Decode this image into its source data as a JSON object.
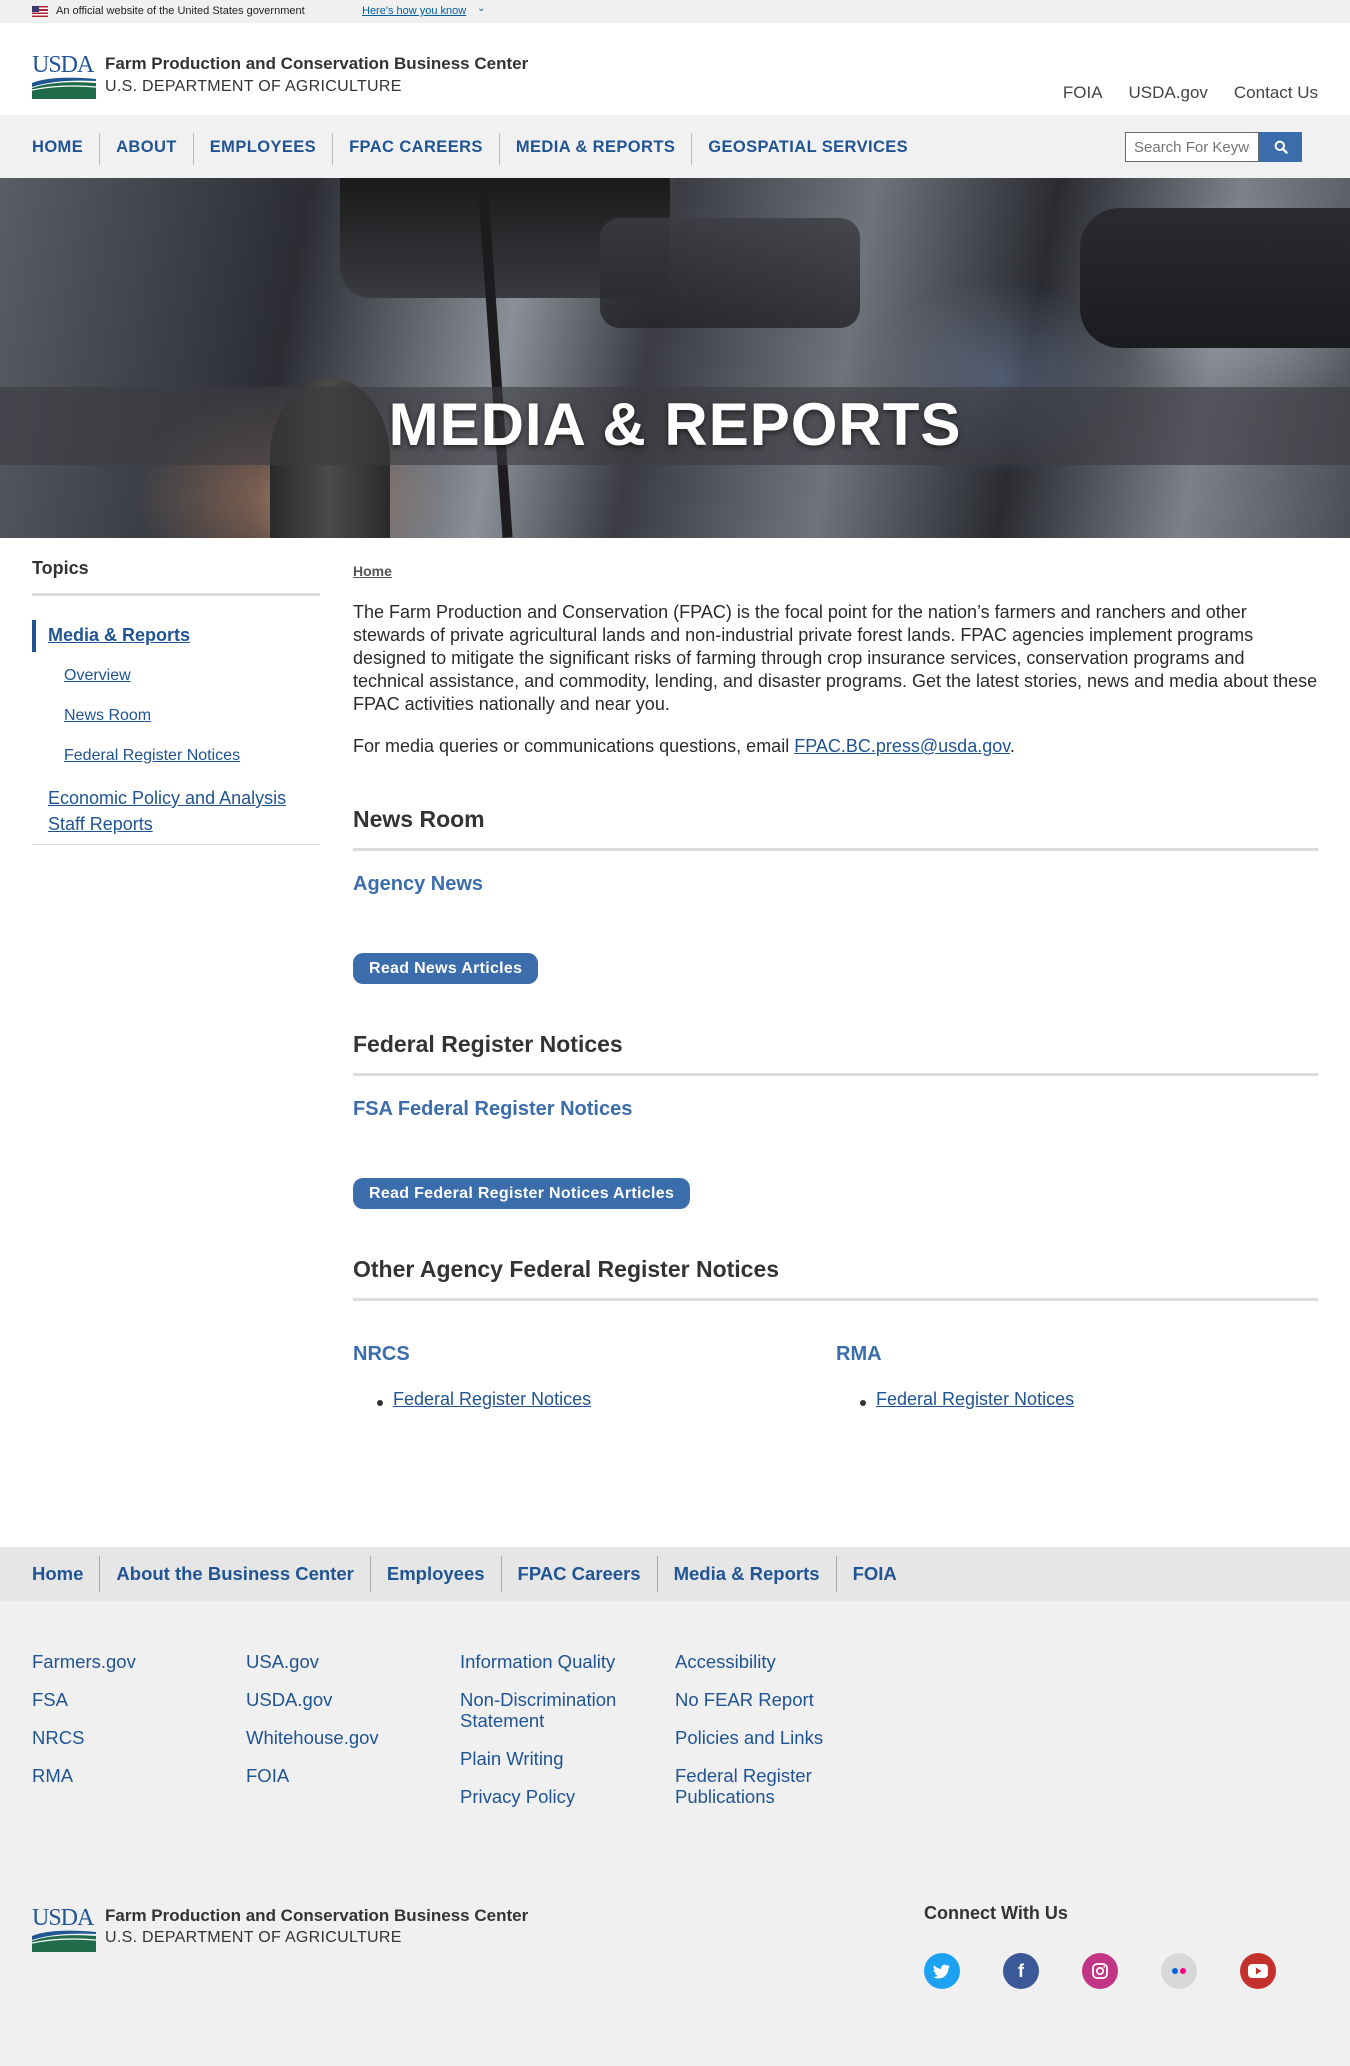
{
  "banner": {
    "official": "An official website of the United States government",
    "how_you_know": "Here's how you know"
  },
  "header": {
    "logo_text": "USDA",
    "title": "Farm Production and Conservation Business Center",
    "subtitle": "U.S. DEPARTMENT OF AGRICULTURE",
    "utility_links": [
      "FOIA",
      "USDA.gov",
      "Contact Us"
    ]
  },
  "nav": {
    "items": [
      "HOME",
      "ABOUT",
      "EMPLOYEES",
      "FPAC CAREERS",
      "MEDIA & REPORTS",
      "GEOSPATIAL SERVICES"
    ],
    "search_placeholder": "Search For Keywords"
  },
  "hero": {
    "title": "MEDIA & REPORTS"
  },
  "sidebar": {
    "heading": "Topics",
    "active": "Media & Reports",
    "sub_items": [
      "Overview",
      "News Room",
      "Federal Register Notices"
    ],
    "other": "Economic Policy and Analysis Staff Reports"
  },
  "content": {
    "breadcrumb": "Home",
    "intro": "The Farm Production and Conservation (FPAC) is the focal point for the nation’s farmers and ranchers and other stewards of private agricultural lands and non-industrial private forest lands. FPAC agencies implement programs designed to mitigate the significant risks of farming through crop insurance services, conservation programs and technical assistance, and commodity, lending, and disaster programs. Get the latest stories, news and media about these FPAC activities nationally and near you.",
    "contact_prefix": "For media queries or communications questions, email ",
    "contact_email": "FPAC.BC.press@usda.gov",
    "contact_suffix": ".",
    "news_room": {
      "title": "News Room",
      "subtitle": "Agency News",
      "button": "Read News Articles"
    },
    "frn": {
      "title": "Federal Register Notices",
      "subtitle": "FSA Federal Register Notices",
      "button": "Read Federal Register Notices Articles"
    },
    "other": {
      "title": "Other Agency Federal Register Notices",
      "agencies": [
        {
          "name": "NRCS",
          "link": "Federal Register Notices"
        },
        {
          "name": "RMA",
          "link": "Federal Register Notices"
        }
      ]
    }
  },
  "footer_nav": [
    "Home",
    "About the Business Center",
    "Employees",
    "FPAC Careers",
    "Media & Reports",
    "FOIA"
  ],
  "footer": {
    "col1": [
      "Farmers.gov",
      "FSA",
      "NRCS",
      "RMA"
    ],
    "col2": [
      "USA.gov",
      "USDA.gov",
      "Whitehouse.gov",
      "FOIA"
    ],
    "col3": [
      "Information Quality",
      "Non-Discrimination Statement",
      "Plain Writing",
      "Privacy Policy"
    ],
    "col4": [
      "Accessibility",
      "No FEAR Report",
      "Policies and Links",
      "Federal Register Publications"
    ],
    "connect": "Connect With Us",
    "social": [
      {
        "icon": "twitter-icon",
        "color": "#1da1f2"
      },
      {
        "icon": "facebook-icon",
        "color": "#3b5998"
      },
      {
        "icon": "instagram-icon",
        "color": "#c13584"
      },
      {
        "icon": "flickr-icon",
        "color": "#d8d8d8"
      },
      {
        "icon": "youtube-icon",
        "color": "#c4302b"
      }
    ]
  }
}
